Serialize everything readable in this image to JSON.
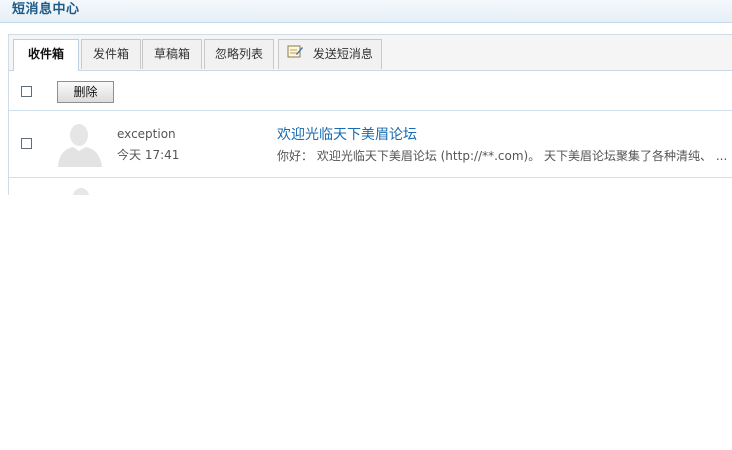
{
  "header": {
    "title": "短消息中心"
  },
  "tabs": [
    {
      "label": "收件箱",
      "active": true
    },
    {
      "label": "发件箱",
      "active": false
    },
    {
      "label": "草稿箱",
      "active": false
    },
    {
      "label": "忽略列表",
      "active": false
    },
    {
      "label": "发送短消息",
      "active": false,
      "icon": "compose-icon"
    }
  ],
  "toolbar": {
    "delete_label": "删除"
  },
  "messages": [
    {
      "sender": "exception",
      "time": "今天  17:41",
      "subject": "欢迎光临天下美眉论坛",
      "preview": "你好：  欢迎光临天下美眉论坛 (http://**.com)。 天下美眉论坛聚集了各种清纯、 ...",
      "avatar_icon": "default-avatar-icon"
    }
  ],
  "colors": {
    "header_title": "#1e5a87",
    "subject_link": "#1a6bb1",
    "border": "#cfe0ec"
  }
}
